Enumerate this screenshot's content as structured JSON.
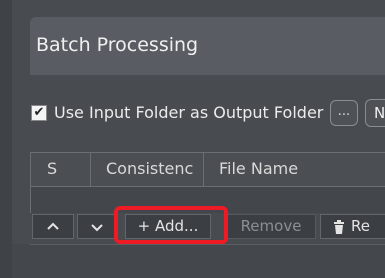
{
  "panel": {
    "title": "Batch Processing"
  },
  "options": {
    "use_input_as_output_checked": true,
    "use_input_as_output_label": "Use Input Folder as Output Folder",
    "browse_label": "...",
    "next_button_label": "N"
  },
  "table": {
    "columns": [
      "S",
      "Consistenc",
      "File Name"
    ],
    "rows": []
  },
  "toolbar": {
    "add_label": "+ Add...",
    "remove_label": "Remove",
    "remove2_label": "Re"
  },
  "icons": {
    "checkbox": "checkmark-icon",
    "move_up": "chevron-up-icon",
    "move_down": "chevron-down-icon",
    "trash": "trash-icon"
  },
  "colors": {
    "highlight": "#ee1b24"
  }
}
